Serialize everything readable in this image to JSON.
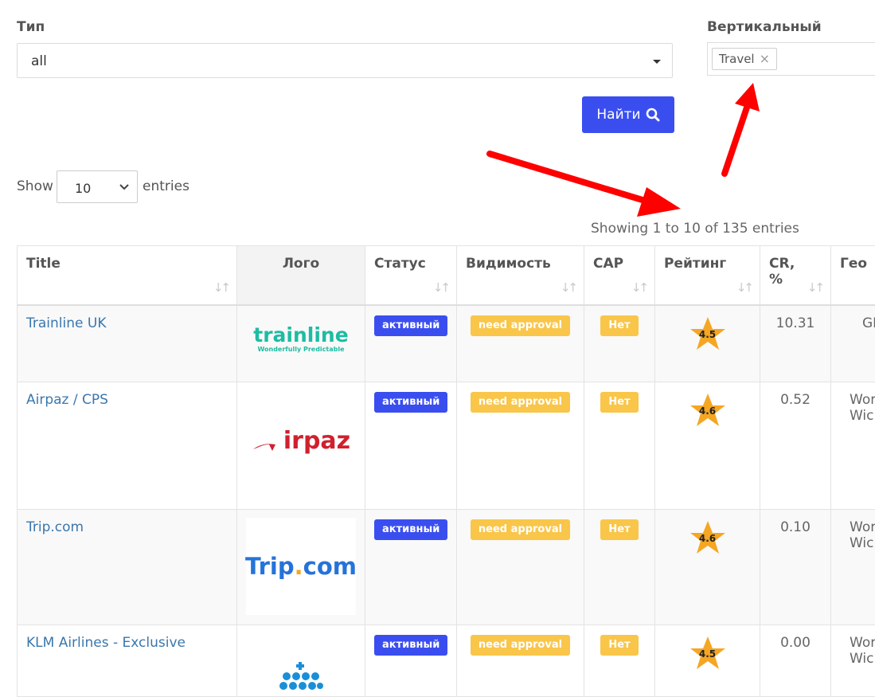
{
  "filters": {
    "type_label": "Тип",
    "type_value": "all",
    "vertical_label": "Вертикальный",
    "vertical_tags": [
      "Travel"
    ],
    "tag_remove": "×",
    "find_label": "Найти"
  },
  "table_controls": {
    "show_label": "Show",
    "entries_label": "entries",
    "page_length": "10",
    "info": "Showing 1 to 10 of 135 entries"
  },
  "columns": {
    "title": "Title",
    "logo": "Лого",
    "status": "Статус",
    "visibility": "Видимость",
    "cap": "CAP",
    "rating": "Рейтинг",
    "cr_line1": "CR,",
    "cr_line2": "%",
    "geo": "Гео"
  },
  "rows": [
    {
      "title": "Trainline UK",
      "logo_text": "trainline",
      "logo_tagline": "Wonderfully Predictable",
      "status": "активный",
      "visibility": "need approval",
      "cap": "Нет",
      "rating": "4.5",
      "cr": "10.31",
      "geo": "GE"
    },
    {
      "title": "Airpaz / CPS",
      "logo_text": "irpaz",
      "status": "активный",
      "visibility": "need approval",
      "cap": "Нет",
      "rating": "4.6",
      "cr": "0.52",
      "geo_line1": "Wor",
      "geo_line2": "Wic"
    },
    {
      "title": "Trip.com",
      "logo_text_a": "Trip",
      "logo_text_dot": ".",
      "logo_text_b": "com",
      "status": "активный",
      "visibility": "need approval",
      "cap": "Нет",
      "rating": "4.6",
      "cr": "0.10",
      "geo_line1": "Wor",
      "geo_line2": "Wic"
    },
    {
      "title": "KLM Airlines - Exclusive",
      "status": "активный",
      "visibility": "need approval",
      "cap": "Нет",
      "rating": "4.5",
      "cr": "0.00",
      "geo_line1": "Wor",
      "geo_line2": "Wic"
    }
  ],
  "colors": {
    "primary": "#3a4ef0",
    "warning": "#f9c64a",
    "link": "#3a77ad",
    "arrow": "#ff0000",
    "star": "#f5a623",
    "trainline": "#1ebca2",
    "airpaz": "#d0202e",
    "trip": "#2573d9",
    "klm": "#1a8fd8"
  },
  "icons": {
    "search": "search-icon",
    "caret": "caret-down-icon",
    "chevron": "chevron-down-icon",
    "sort": "sort-icon",
    "star": "star-icon",
    "arrow": "red-arrow-annotation"
  }
}
